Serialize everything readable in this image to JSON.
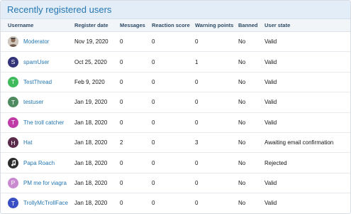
{
  "panel": {
    "title": "Recently registered users"
  },
  "columns": [
    "Username",
    "Register date",
    "Messages",
    "Reaction score",
    "Warning points",
    "Banned",
    "User state"
  ],
  "rows": [
    {
      "avatar": {
        "type": "photo",
        "color": "#a08a78",
        "letter": ""
      },
      "username": "Moderator",
      "register_date": "Nov 19, 2020",
      "messages": "0",
      "reaction_score": "0",
      "warning_points": "0",
      "banned": "No",
      "user_state": "Valid"
    },
    {
      "avatar": {
        "type": "letter",
        "color": "#33337a",
        "letter": "S"
      },
      "username": "spamUser",
      "register_date": "Oct 25, 2020",
      "messages": "0",
      "reaction_score": "0",
      "warning_points": "1",
      "banned": "No",
      "user_state": "Valid"
    },
    {
      "avatar": {
        "type": "letter",
        "color": "#3fbb5c",
        "letter": "T"
      },
      "username": "TestThread",
      "register_date": "Feb 9, 2020",
      "messages": "0",
      "reaction_score": "0",
      "warning_points": "0",
      "banned": "No",
      "user_state": "Valid"
    },
    {
      "avatar": {
        "type": "letter",
        "color": "#4f8a60",
        "letter": "T"
      },
      "username": "testuser",
      "register_date": "Jan 19, 2020",
      "messages": "0",
      "reaction_score": "0",
      "warning_points": "0",
      "banned": "No",
      "user_state": "Valid"
    },
    {
      "avatar": {
        "type": "letter",
        "color": "#c03aa8",
        "letter": "T"
      },
      "username": "The troll catcher",
      "register_date": "Jan 18, 2020",
      "messages": "0",
      "reaction_score": "0",
      "warning_points": "0",
      "banned": "No",
      "user_state": "Valid"
    },
    {
      "avatar": {
        "type": "letter",
        "color": "#5a2a4a",
        "letter": "H"
      },
      "username": "Hat",
      "register_date": "Jan 18, 2020",
      "messages": "2",
      "reaction_score": "0",
      "warning_points": "3",
      "banned": "No",
      "user_state": "Awaiting email confirmation"
    },
    {
      "avatar": {
        "type": "music",
        "color": "#2b2b2b",
        "letter": ""
      },
      "username": "Papa Roach",
      "register_date": "Jan 18, 2020",
      "messages": "0",
      "reaction_score": "0",
      "warning_points": "0",
      "banned": "No",
      "user_state": "Rejected"
    },
    {
      "avatar": {
        "type": "letter",
        "color": "#c98ad0",
        "letter": "P"
      },
      "username": "PM me for viagra",
      "register_date": "Jan 18, 2020",
      "messages": "0",
      "reaction_score": "0",
      "warning_points": "0",
      "banned": "No",
      "user_state": "Valid"
    },
    {
      "avatar": {
        "type": "letter",
        "color": "#3b4fc4",
        "letter": "T"
      },
      "username": "TrollyMcTrollFace",
      "register_date": "Jan 18, 2020",
      "messages": "0",
      "reaction_score": "0",
      "warning_points": "0",
      "banned": "No",
      "user_state": "Valid"
    }
  ]
}
